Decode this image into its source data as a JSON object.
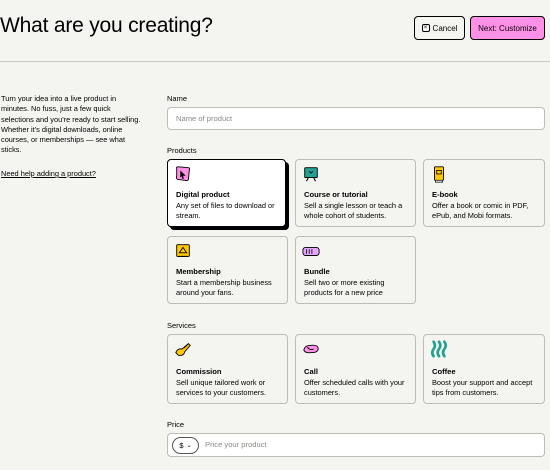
{
  "header": {
    "title": "What are you creating?",
    "cancel_label": "Cancel",
    "next_label": "Next: Customize"
  },
  "intro": {
    "text": "Turn your idea into a live product in minutes. No fuss, just a few quick selections and you're ready to start selling. Whether it's digital downloads, online courses, or memberships — see what sticks.",
    "help_link": "Need help adding a product?"
  },
  "name_field": {
    "label": "Name",
    "placeholder": "Name of product"
  },
  "products": {
    "heading": "Products",
    "items": [
      {
        "title": "Digital product",
        "desc": "Any set of files to download or stream.",
        "selected": true
      },
      {
        "title": "Course or tutorial",
        "desc": "Sell a single lesson or teach a whole cohort of students."
      },
      {
        "title": "E-book",
        "desc": "Offer a book or comic in PDF, ePub, and Mobi formats."
      },
      {
        "title": "Membership",
        "desc": "Start a membership business around your fans."
      },
      {
        "title": "Bundle",
        "desc": "Sell two or more existing products for a new price"
      }
    ]
  },
  "services": {
    "heading": "Services",
    "items": [
      {
        "title": "Commission",
        "desc": "Sell unique tailored work or services to your customers."
      },
      {
        "title": "Call",
        "desc": "Offer scheduled calls with your customers."
      },
      {
        "title": "Coffee",
        "desc": "Boost your support and accept tips from customers."
      }
    ]
  },
  "price_field": {
    "label": "Price",
    "currency": "$",
    "placeholder": "Price your product"
  },
  "colors": {
    "accent_pink": "#ff90e8",
    "background": "#f4f4f0"
  }
}
